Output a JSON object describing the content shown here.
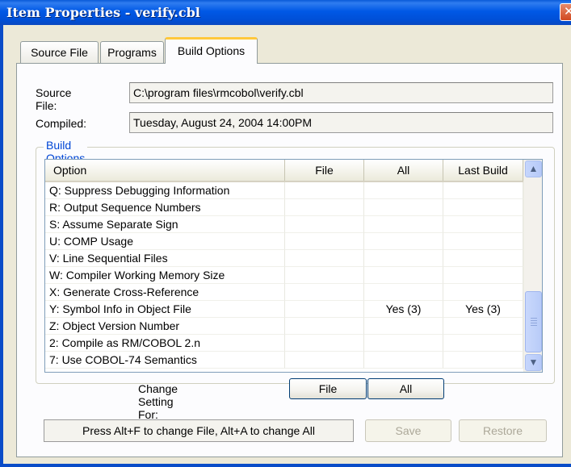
{
  "window": {
    "title": "Item Properties - verify.cbl",
    "close_icon": "close-icon"
  },
  "tabs": [
    {
      "label": "Source File"
    },
    {
      "label": "Programs"
    },
    {
      "label": "Build Options",
      "active": true
    }
  ],
  "fields": {
    "source_file_label": "Source File:",
    "source_file_value": "C:\\program files\\rmcobol\\verify.cbl",
    "compiled_label": "Compiled:",
    "compiled_value": "Tuesday, August 24, 2004 14:00PM"
  },
  "group": {
    "legend": "Build Options"
  },
  "list": {
    "columns": [
      "Option",
      "File",
      "All",
      "Last Build"
    ],
    "rows": [
      {
        "option": "Q: Suppress Debugging Information",
        "file": "",
        "all": "",
        "last": ""
      },
      {
        "option": "R: Output Sequence Numbers",
        "file": "",
        "all": "",
        "last": ""
      },
      {
        "option": "S: Assume Separate Sign",
        "file": "",
        "all": "",
        "last": ""
      },
      {
        "option": "U: COMP Usage",
        "file": "",
        "all": "",
        "last": ""
      },
      {
        "option": "V: Line Sequential Files",
        "file": "",
        "all": "",
        "last": ""
      },
      {
        "option": "W: Compiler Working Memory Size",
        "file": "",
        "all": "",
        "last": ""
      },
      {
        "option": "X: Generate Cross-Reference",
        "file": "",
        "all": "",
        "last": ""
      },
      {
        "option": "Y: Symbol Info in Object File",
        "file": "",
        "all": "Yes (3)",
        "last": "Yes (3)"
      },
      {
        "option": "Z: Object Version Number",
        "file": "",
        "all": "",
        "last": ""
      },
      {
        "option": "2: Compile as RM/COBOL 2.n",
        "file": "",
        "all": "",
        "last": ""
      },
      {
        "option": "7: Use COBOL-74 Semantics",
        "file": "",
        "all": "",
        "last": ""
      }
    ],
    "scrollbar": {
      "up_icon": "chevron-up-icon",
      "down_icon": "chevron-down-icon",
      "position": 0.85
    }
  },
  "change_setting": {
    "label": "Change Setting For:",
    "file_button": "File",
    "all_button": "All"
  },
  "status_text": "Press Alt+F to change File, Alt+A to change All",
  "buttons": {
    "save": "Save",
    "restore": "Restore"
  }
}
